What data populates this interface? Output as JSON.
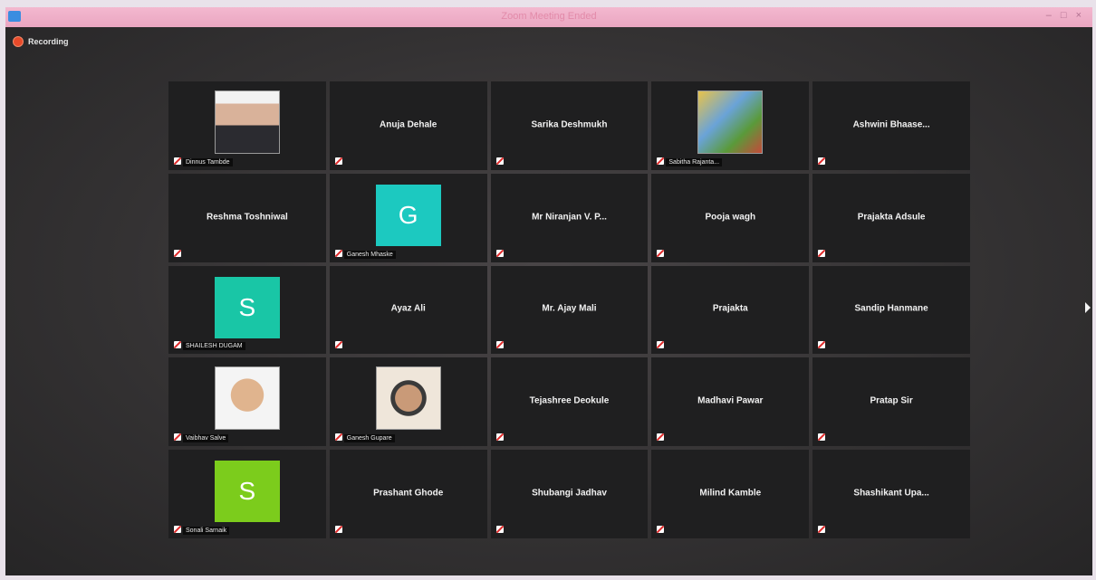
{
  "window": {
    "title": "Zoom Meeting Ended",
    "controls": [
      "–",
      "□",
      "×"
    ]
  },
  "recording": {
    "label": "Recording"
  },
  "participants": [
    {
      "name": "Dinnus Tambde",
      "video": "photo",
      "photo": "pic-man"
    },
    {
      "name": "Anuja Dehale",
      "video": "off"
    },
    {
      "name": "Sarika Deshmukh",
      "video": "off"
    },
    {
      "name": "Sabitha Rajanta...",
      "video": "photo",
      "photo": "pic-outdoor"
    },
    {
      "name": "Ashwini Bhaase...",
      "video": "off"
    },
    {
      "name": "Reshma Toshniwal",
      "video": "off"
    },
    {
      "name": "Ganesh Mhaske",
      "video": "avatar",
      "initial": "G",
      "color": "#1cc9c0"
    },
    {
      "name": "Mr Niranjan V. P...",
      "video": "off"
    },
    {
      "name": "Pooja wagh",
      "video": "off"
    },
    {
      "name": "Prajakta Adsule",
      "video": "off"
    },
    {
      "name": "SHAILESH DUGAM",
      "video": "avatar",
      "initial": "S",
      "color": "#19c6a6"
    },
    {
      "name": "Ayaz Ali",
      "video": "off"
    },
    {
      "name": "Mr. Ajay Mali",
      "video": "off"
    },
    {
      "name": "Prajakta",
      "video": "off"
    },
    {
      "name": "Sandip Hanmane",
      "video": "off"
    },
    {
      "name": "Vaibhav Salve",
      "video": "photo",
      "photo": "pic-face1"
    },
    {
      "name": "Ganesh Gupare",
      "video": "photo",
      "photo": "pic-face2"
    },
    {
      "name": "Tejashree Deokule",
      "video": "off"
    },
    {
      "name": "Madhavi Pawar",
      "video": "off"
    },
    {
      "name": "Pratap Sir",
      "video": "off"
    },
    {
      "name": "Sonali Sarnaik",
      "video": "avatar",
      "initial": "S",
      "color": "#7ccc1c"
    },
    {
      "name": "Prashant Ghode",
      "video": "off"
    },
    {
      "name": "Shubangi Jadhav",
      "video": "off"
    },
    {
      "name": "Milind Kamble",
      "video": "off"
    },
    {
      "name": "Shashikant Upa...",
      "video": "off"
    }
  ]
}
